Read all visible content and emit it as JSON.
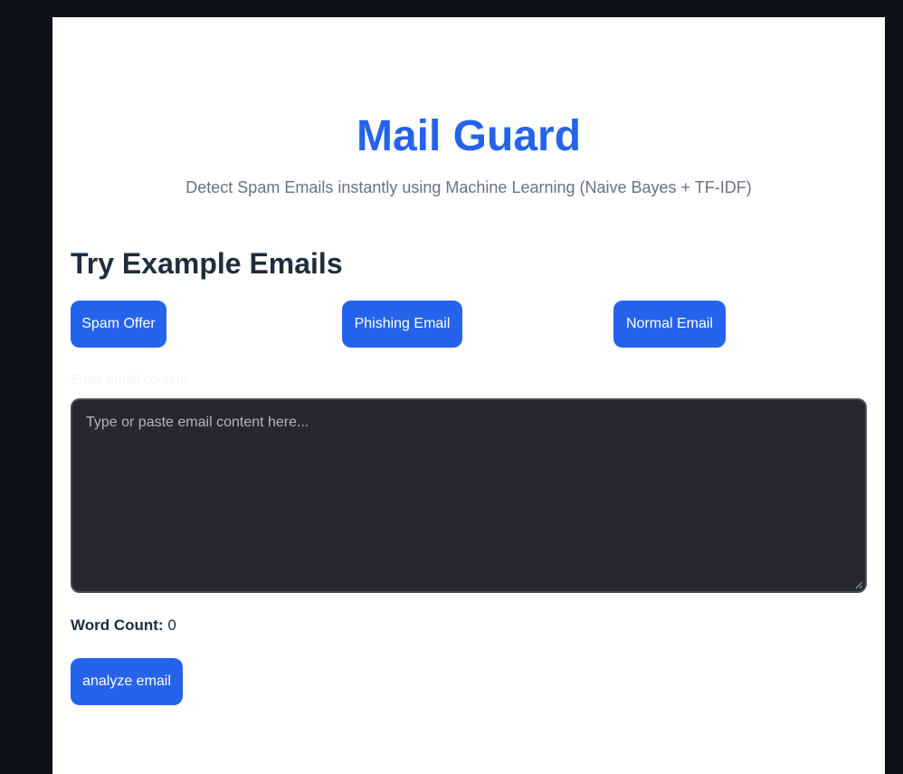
{
  "header": {
    "title": "Mail Guard",
    "subtitle": "Detect Spam Emails instantly using Machine Learning (Naive Bayes + TF-IDF)"
  },
  "examples": {
    "heading": "Try Example Emails",
    "buttons": [
      {
        "label": "Spam Offer"
      },
      {
        "label": "Phishing Email"
      },
      {
        "label": "Normal Email"
      }
    ]
  },
  "email_input": {
    "label": "Enter email content",
    "value": "",
    "placeholder": "Type or paste email content here..."
  },
  "word_count": {
    "label": "Word Count:",
    "value": "0"
  },
  "actions": {
    "analyze_label": "analyze email"
  },
  "colors": {
    "accent": "#2563eb",
    "background": "#0d1017",
    "card": "#ffffff",
    "textarea_bg": "#262730"
  }
}
